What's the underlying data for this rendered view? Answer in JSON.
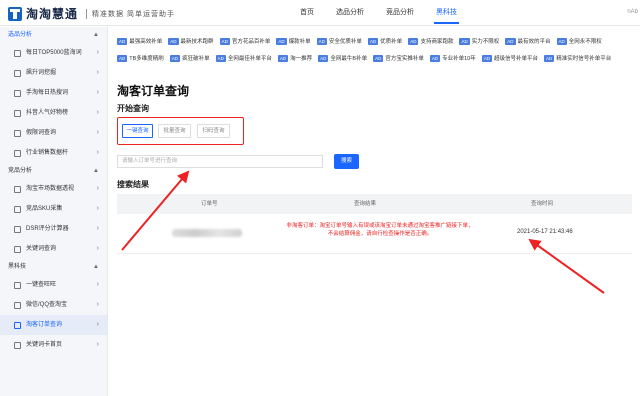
{
  "header": {
    "logo_text": "淘淘慧通",
    "slogan": "精准数据  简单运营助手",
    "nav": [
      "首页",
      "选品分析",
      "竞品分析",
      "黑科技"
    ],
    "active_nav": "黑科技",
    "user": "nAb"
  },
  "sidebar": {
    "sections": [
      {
        "title": "选品分析",
        "items": [
          {
            "label": "每日TOP5000蓝海词",
            "icon": "chart-icon"
          },
          {
            "label": "飙升词挖掘",
            "icon": "trend-icon"
          },
          {
            "label": "手淘每日热搜词",
            "icon": "fire-icon"
          },
          {
            "label": "抖音人气好物榜",
            "icon": "douyin-icon"
          },
          {
            "label": "假限词查询",
            "icon": "block-icon"
          },
          {
            "label": "行业销售数据杆",
            "icon": "bar-icon"
          }
        ]
      },
      {
        "title": "竞品分析",
        "items": [
          {
            "label": "淘宝市场数据透视",
            "icon": "globe-icon"
          },
          {
            "label": "竞品SKU采集",
            "icon": "box-icon"
          },
          {
            "label": "DSR评分计算器",
            "icon": "calc-icon"
          },
          {
            "label": "关键词查询",
            "icon": "search-icon"
          }
        ]
      },
      {
        "title": "黑科技",
        "items": [
          {
            "label": "一键查旺旺",
            "icon": "user-icon"
          },
          {
            "label": "微信/QQ查淘宝",
            "icon": "chat-icon"
          },
          {
            "label": "淘客订单查询",
            "icon": "order-icon"
          },
          {
            "label": "关键词卡首页",
            "icon": "key-icon"
          }
        ]
      }
    ],
    "active_item": "淘客订单查询"
  },
  "tags": {
    "row1": [
      "最强高效补单",
      "最新技术跑群",
      "官方花品百补单",
      "爆款补单",
      "安全优质补单",
      "优质补单",
      "支持商家跑款",
      "实力不限权",
      "最有效的平台",
      "全网永不限权"
    ],
    "row2": [
      "TB多维度精刷",
      "疯狂破补单",
      "全网最佳补单平台",
      "淘一推荐",
      "全网最牛B补单",
      "官方宝实推补单",
      "专业补单10年",
      "超级信号补单平台",
      "精准实时信号补单平台"
    ],
    "badge": "AD"
  },
  "main": {
    "page_title": "淘客订单查询",
    "section_title": "开始查询",
    "query_tabs": [
      "一键查询",
      "批量查询",
      "扫码查询"
    ],
    "search_placeholder": "请输入订单号进行查询",
    "search_button": "搜索",
    "results_title": "搜索结果",
    "columns": [
      "订单号",
      "查询结果",
      "查询时间"
    ],
    "row": {
      "result": "非淘客订单：淘宝订单号输入有误或该淘宝订单未通过淘宝客推广链接下单，不会结算佣金，请自行检查操作是否正确。",
      "time": "2021-05-17 21:43:46"
    }
  },
  "colors": {
    "accent": "#1a66ff",
    "highlight": "#e22222",
    "sidebar_bg": "#f4f6fa"
  }
}
